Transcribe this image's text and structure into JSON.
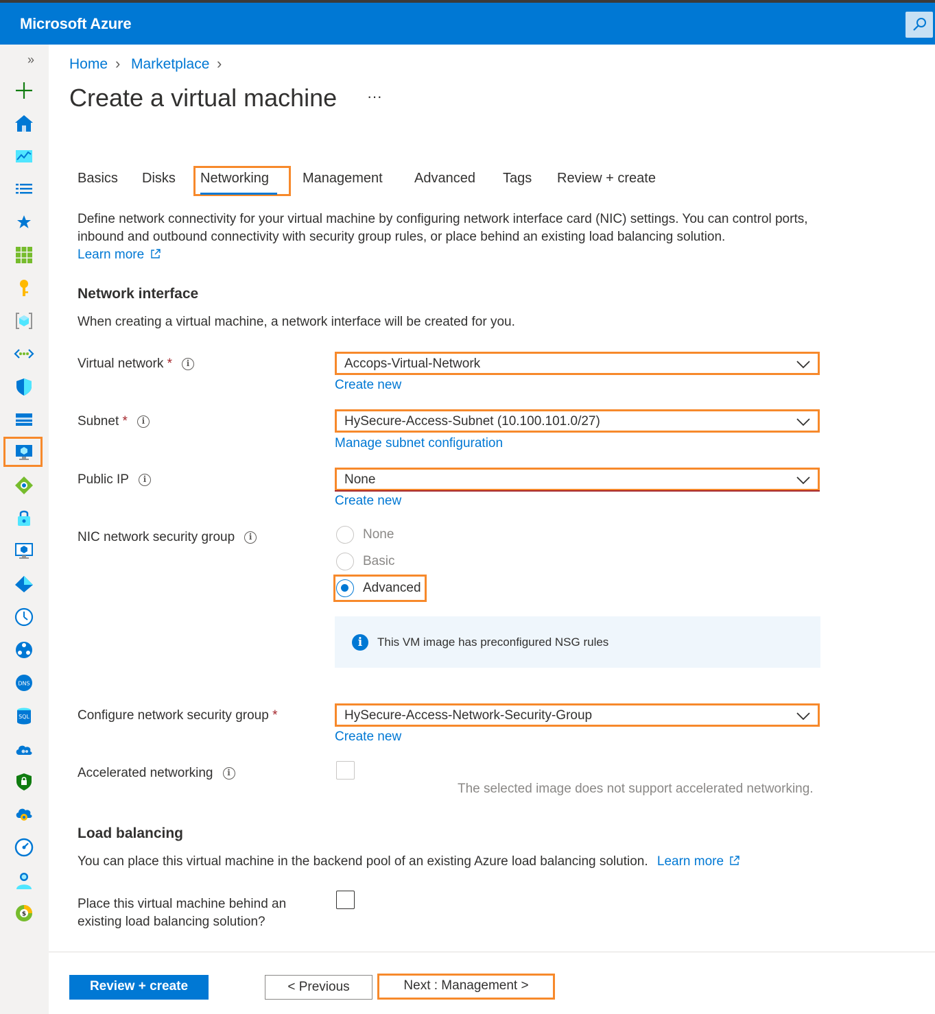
{
  "app": {
    "brand": "Microsoft Azure"
  },
  "breadcrumb": {
    "home": "Home",
    "marketplace": "Marketplace"
  },
  "page": {
    "title": "Create a virtual machine",
    "more": "···"
  },
  "tabs": [
    {
      "label": "Basics"
    },
    {
      "label": "Disks"
    },
    {
      "label": "Networking",
      "active": true
    },
    {
      "label": "Management"
    },
    {
      "label": "Advanced"
    },
    {
      "label": "Tags"
    },
    {
      "label": "Review + create"
    }
  ],
  "intro": {
    "text": "Define network connectivity for your virtual machine by configuring network interface card (NIC) settings. You can control ports, inbound and outbound connectivity with security group rules, or place behind an existing load balancing solution.",
    "learn_more": "Learn more"
  },
  "network_interface": {
    "heading": "Network interface",
    "description": "When creating a virtual machine, a network interface will be created for you.",
    "virtual_network": {
      "label": "Virtual network",
      "required": "*",
      "value": "Accops-Virtual-Network",
      "link": "Create new"
    },
    "subnet": {
      "label": "Subnet",
      "required": "*",
      "value": "HySecure-Access-Subnet (10.100.101.0/27)",
      "link": "Manage subnet configuration"
    },
    "public_ip": {
      "label": "Public IP",
      "value": "None",
      "link": "Create new"
    },
    "nic_nsg": {
      "label": "NIC network security group",
      "options": [
        "None",
        "Basic",
        "Advanced"
      ],
      "selected": "Advanced"
    },
    "nsg_info": "This VM image has preconfigured NSG rules",
    "configure_nsg": {
      "label": "Configure network security group",
      "required": "*",
      "value": "HySecure-Access-Network-Security-Group",
      "link": "Create new"
    },
    "accelerated": {
      "label": "Accelerated networking",
      "note": "The selected image does not support accelerated networking."
    }
  },
  "load_balancing": {
    "heading": "Load balancing",
    "description": "You can place this virtual machine in the backend pool of an existing Azure load balancing solution.",
    "learn_more": "Learn more",
    "place_label_1": "Place this virtual machine behind an",
    "place_label_2": "existing load balancing solution?"
  },
  "footer": {
    "review_create": "Review + create",
    "previous": "< Previous",
    "next": "Next : Management >"
  },
  "sidebar_icons": [
    "expand-icon",
    "create-resource-icon",
    "home-icon",
    "dashboard-icon",
    "all-services-icon",
    "favorites-icon",
    "all-resources-icon",
    "key-vault-icon",
    "resource-groups-icon",
    "virtual-networks-icon",
    "security-center-icon",
    "storage-icon",
    "virtual-machines-icon",
    "load-balancer-icon",
    "vpn-icon",
    "vm-icon",
    "active-directory-icon",
    "monitor-icon",
    "network-watcher-icon",
    "dns-icon",
    "sql-icon",
    "cloud-services-icon",
    "defender-icon",
    "app-service-icon",
    "advisor-icon",
    "users-icon",
    "cost-management-icon"
  ],
  "colors": {
    "accent": "#0078d4",
    "highlight": "#f7892b",
    "required": "#a4262c"
  }
}
